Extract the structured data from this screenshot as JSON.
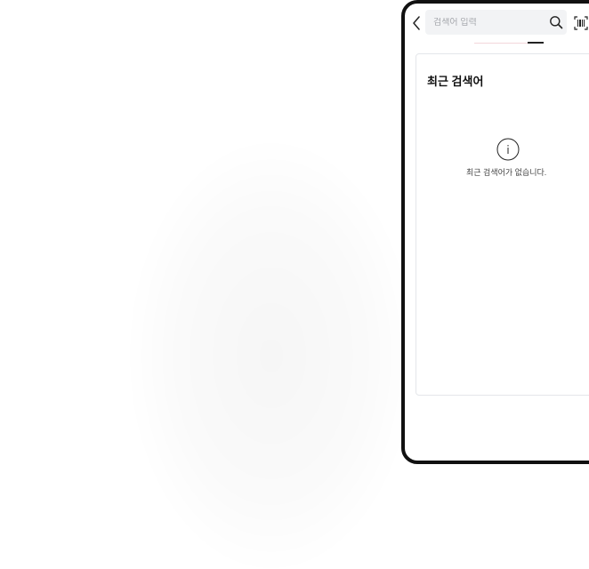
{
  "search": {
    "placeholder": "검색어 입력"
  },
  "icons": {
    "back": "chevron-left-icon",
    "search": "search-icon",
    "barcode": "barcode-scan-icon",
    "info": "info-icon"
  },
  "recent_searches": {
    "title": "최근 검색어",
    "empty_message": "최근 검색어가 없습니다."
  },
  "colors": {
    "device_frame": "#111111",
    "search_bg": "#f2f3f5",
    "tab_accent": "#f3d6db",
    "card_border": "#e4e6ea"
  }
}
